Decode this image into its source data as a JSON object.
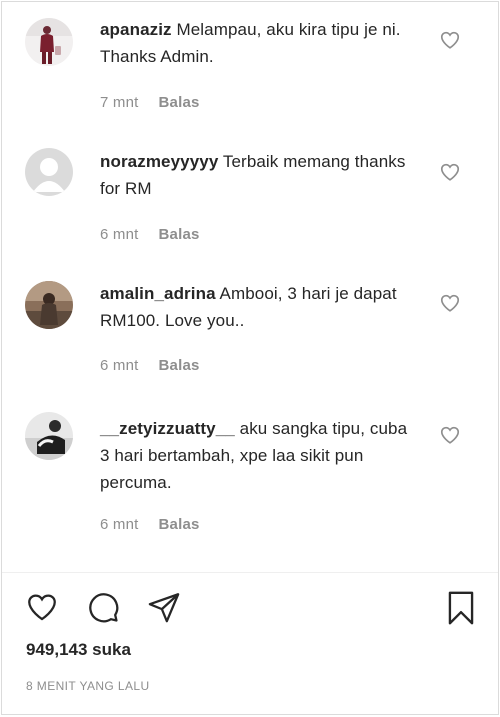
{
  "comments": [
    {
      "username": "apanaziz",
      "text": " Melampau, aku kira tipu je ni. Thanks Admin.",
      "time": "7 mnt",
      "reply": "Balas",
      "avatar": "avatar-icon"
    },
    {
      "username": "norazmeyyyyy",
      "text": " Terbaik memang thanks for RM",
      "time": "6 mnt",
      "reply": "Balas",
      "avatar": "default-avatar-icon"
    },
    {
      "username": "amalin_adrina",
      "text": " Ambooi, 3 hari je dapat RM100. Love you..",
      "time": "6 mnt",
      "reply": "Balas",
      "avatar": "avatar-icon"
    },
    {
      "username": "__zetyizzuatty__",
      "text": " aku sangka tipu, cuba 3 hari bertambah, xpe laa sikit pun percuma.",
      "time": "6 mnt",
      "reply": "Balas",
      "avatar": "avatar-icon"
    }
  ],
  "actions": {
    "like_icon": "heart-icon",
    "comment_icon": "comment-icon",
    "share_icon": "send-icon",
    "save_icon": "bookmark-icon"
  },
  "likes": "949,143 suka",
  "posted": "8 MENIT YANG LALU",
  "colors": {
    "text": "#262626",
    "muted": "#8e8e8e",
    "border": "#dbdbdb"
  }
}
